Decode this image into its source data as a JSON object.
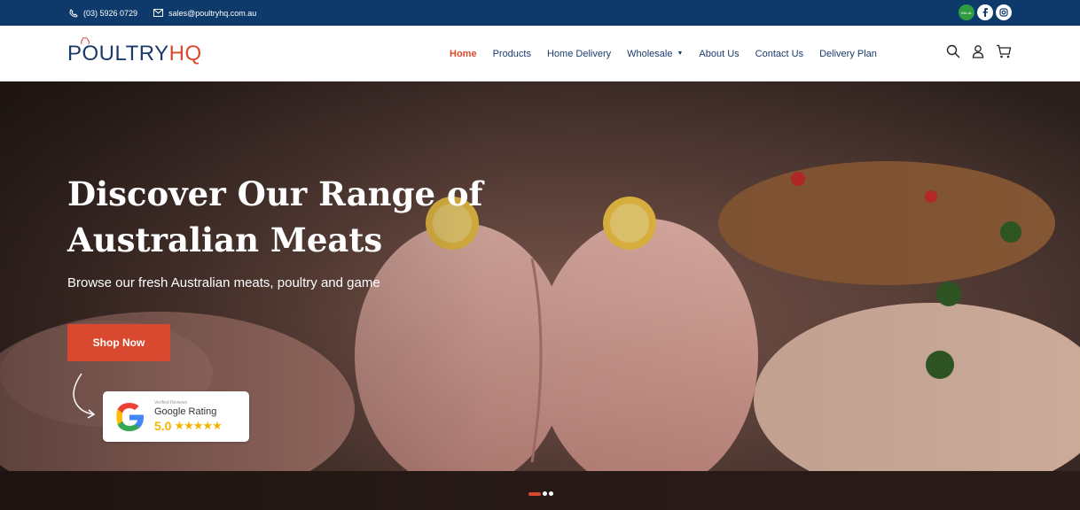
{
  "topbar": {
    "phone": "(03) 5926 0729",
    "email": "sales@poultryhq.com.au",
    "phone_icon": "phone-icon",
    "email_icon": "mail-icon",
    "social": [
      "halal-badge",
      "facebook-icon",
      "instagram-icon"
    ],
    "halal_text": "HALAL"
  },
  "header": {
    "logo_part1": "POULTRY",
    "logo_part2": "HQ",
    "nav": [
      {
        "label": "Home",
        "active": true
      },
      {
        "label": "Products"
      },
      {
        "label": "Home Delivery"
      },
      {
        "label": "Wholesale",
        "caret": "▼"
      },
      {
        "label": "About Us"
      },
      {
        "label": "Contact Us"
      },
      {
        "label": "Delivery Plan"
      }
    ],
    "icons": [
      "search-icon",
      "user-icon",
      "cart-icon"
    ]
  },
  "hero": {
    "title": "Discover Our Range of Australian Meats",
    "subtitle": "Browse our fresh Australian meats, poultry and game",
    "cta": "Shop Now",
    "rating": {
      "verified": "Verified Reviews",
      "name": "Google Rating",
      "score": "5.0",
      "stars": "★★★★★"
    },
    "slides": 3,
    "active_slide": 1
  },
  "colors": {
    "navy": "#0e3a6b",
    "accent": "#d9492f",
    "star": "#f4b400"
  }
}
